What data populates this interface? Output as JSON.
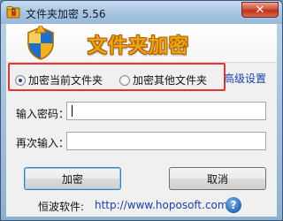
{
  "window": {
    "title": "文件夹加密 5.56",
    "close_icon": "close-icon"
  },
  "banner": {
    "icon": "shield-icon",
    "title": "文件夹加密"
  },
  "options": {
    "radio_current": "加密当前文件夹",
    "radio_other": "加密其他文件夹",
    "selected": "加密当前文件夹",
    "advanced_link": "高级设置"
  },
  "form": {
    "password_label": "输入密码：",
    "password_value": "",
    "confirm_label": "再次输入：",
    "confirm_value": ""
  },
  "buttons": {
    "encrypt": "加密",
    "cancel": "取消"
  },
  "footer": {
    "label": "恒波软件:",
    "url": "http://www.hoposoft.com",
    "help_icon": "help-icon"
  },
  "colors": {
    "highlight_border": "#e23535",
    "banner_title": "#e8a515",
    "link": "#1a3fa8"
  }
}
